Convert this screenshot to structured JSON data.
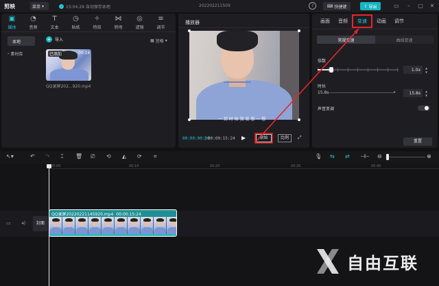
{
  "titlebar": {
    "app_name": "剪映",
    "menu_label": "菜单",
    "autosave_text": "15:04:29 自动保存本地",
    "project_title": "202202211509",
    "shortcut_label": "快捷键",
    "export_label": "导出"
  },
  "media": {
    "tabs": [
      {
        "label": "媒体",
        "icon": "media-icon"
      },
      {
        "label": "音频",
        "icon": "audio-icon"
      },
      {
        "label": "文本",
        "icon": "text-icon"
      },
      {
        "label": "贴纸",
        "icon": "sticker-icon"
      },
      {
        "label": "特效",
        "icon": "effects-icon"
      },
      {
        "label": "转场",
        "icon": "transition-icon"
      },
      {
        "label": "滤镜",
        "icon": "filter-icon"
      },
      {
        "label": "调节",
        "icon": "adjust-icon"
      }
    ],
    "side_local": "本地",
    "side_library": "素材库",
    "import_label": "导入",
    "view_label": "宫格",
    "clip_badge": "已添加",
    "clip_duration": "00:16",
    "clip_filename": "QQ录屏202...920.mp4"
  },
  "player": {
    "title": "播放器",
    "subtitle": "一 到 时 候 我 就 想 一 想",
    "current_time": "00:00:00:00",
    "total_time": "00:00:15:24",
    "original_btn": "原始",
    "ratio_btn": "比例"
  },
  "props": {
    "tabs": [
      "画面",
      "音频",
      "变速",
      "动画",
      "调节"
    ],
    "active_tab_index": 2,
    "mode_normal": "常规变速",
    "mode_curve": "曲线变速",
    "multiplier_label": "倍数",
    "multiplier_value": "1.0x",
    "multiplier_level": 0.17,
    "duration_label": "时长",
    "duration_from": "15.8s",
    "duration_value": "15.8s",
    "pitch_label": "声音变调",
    "pitch_on": false,
    "reset_label": "重置"
  },
  "timeline": {
    "ticks": [
      "00:00",
      "00:10",
      "00:20",
      "00:30",
      "00:40"
    ],
    "cover_label": "封面",
    "clip_name": "QQ录屏20220221145920.mp4",
    "clip_duration": "00:00:15:24"
  },
  "watermark": {
    "text": "自由互联"
  },
  "colors": {
    "accent": "#22c8d1",
    "annotation": "#e5262b",
    "export": "#18b4c0"
  }
}
